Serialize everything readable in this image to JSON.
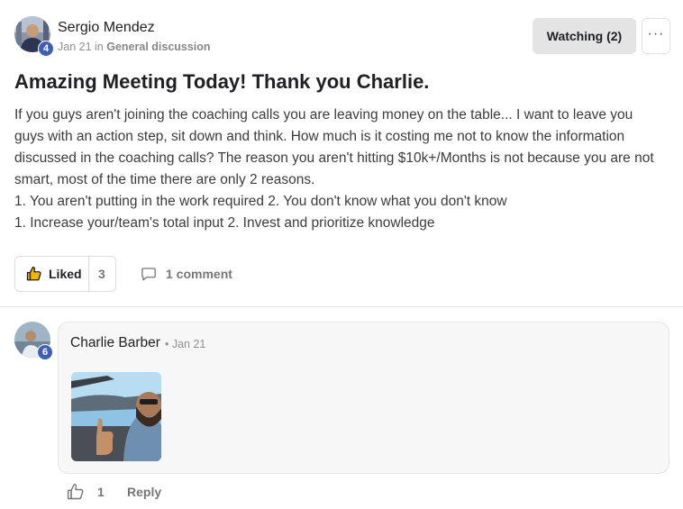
{
  "post": {
    "author": "Sergio Mendez",
    "author_level": "4",
    "date": "Jan 21",
    "in_word": "in",
    "category": "General discussion",
    "title": "Amazing Meeting Today! Thank you Charlie.",
    "body": [
      "If you guys aren't joining the coaching calls you are leaving money on the table... I want to leave you guys with an action step, sit down and think. How much is it costing me not to know the information discussed in the coaching calls? The reason you aren't hitting $10k+/Months is not because you are not smart, most of the time there are only 2 reasons.",
      "1. You aren't putting in the work required 2. You don't know what you don't know",
      "1. Increase your/team's total input 2. Invest and prioritize knowledge"
    ],
    "liked_label": "Liked",
    "like_count": "3",
    "comment_label": "1 comment"
  },
  "header": {
    "watching_label": "Watching (2)",
    "more_label": "···"
  },
  "comment": {
    "author": "Charlie Barber",
    "author_level": "6",
    "date": "• Jan 21",
    "like_count": "1",
    "reply_label": "Reply"
  },
  "colors": {
    "badge": "#3f5fb3",
    "watch_bg": "#e4e4e4",
    "muted_text": "#777777",
    "card_bg": "#f7f7f7"
  },
  "icons": [
    "thumbs-up-icon",
    "comment-bubble-icon",
    "more-icon"
  ]
}
